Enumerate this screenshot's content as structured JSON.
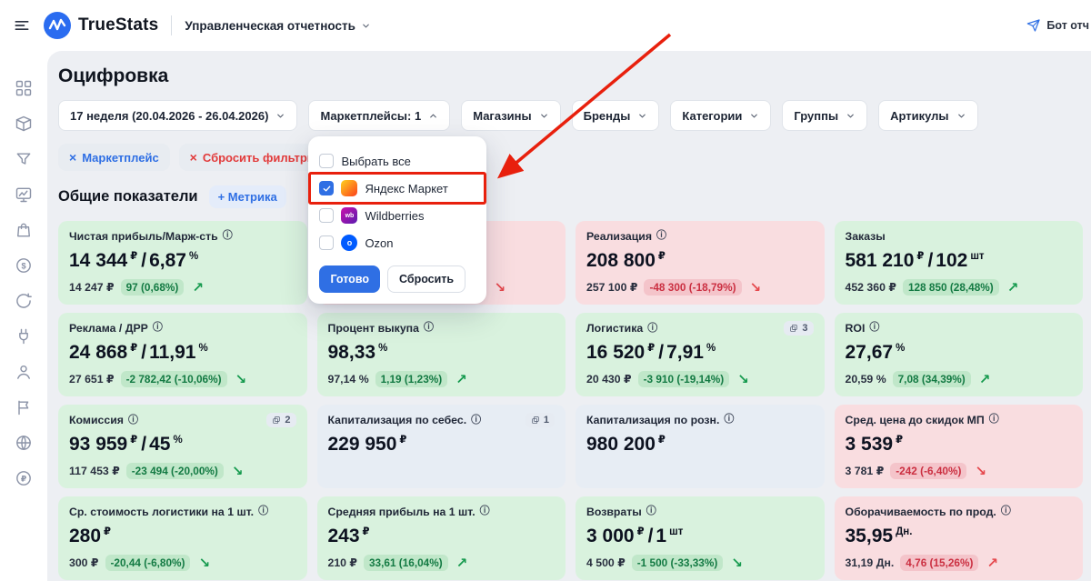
{
  "colors": {
    "accent_blue": "#2f6fe4",
    "good_bg": "#d9f2de",
    "bad_bg": "#f9dde0",
    "neutral_bg": "#e7edf4",
    "good_text": "#137a43",
    "bad_text": "#cb2f41",
    "annotation_red": "#e8200d"
  },
  "header": {
    "app_name": "TrueStats",
    "section_label": "Управленческая отчетность",
    "bot_label": "Бот отч"
  },
  "sidebar": {
    "icons": [
      "grid",
      "box",
      "filter",
      "chart",
      "bag",
      "dollar-circle",
      "sync",
      "plug",
      "user",
      "flag",
      "globe",
      "ruble-circle"
    ]
  },
  "page": {
    "title": "Оцифровка",
    "week_filter": "17 неделя (20.04.2026 - 26.04.2026)",
    "filter_buttons": [
      {
        "label": "Маркетплейсы: 1",
        "open": true
      },
      {
        "label": "Магазины"
      },
      {
        "label": "Бренды"
      },
      {
        "label": "Категории"
      },
      {
        "label": "Группы"
      },
      {
        "label": "Артикулы"
      }
    ],
    "chips": [
      {
        "label": "Маркетплейс",
        "color": "blue"
      },
      {
        "label": "Сбросить фильтры",
        "color": "red"
      }
    ],
    "section_title": "Общие показатели",
    "add_metric_label": "+ Метрика"
  },
  "marketplace_dropdown": {
    "select_all": "Выбрать все",
    "options": [
      {
        "label": "Яндекс Маркет",
        "checked": true,
        "icon": "yandex",
        "highlighted": true
      },
      {
        "label": "Wildberries",
        "checked": false,
        "icon": "wb"
      },
      {
        "label": "Ozon",
        "checked": false,
        "icon": "ozon"
      }
    ],
    "done_label": "Готово",
    "reset_label": "Сбросить"
  },
  "cards": [
    {
      "title": "Чистая прибыль/Марж-сть",
      "info": true,
      "tone": "good",
      "values": [
        {
          "n": "14 344",
          "u": "₽"
        },
        {
          "n": "6,87",
          "u": "%"
        }
      ],
      "prev": "14 247 ₽",
      "change": "97 (0,68%)",
      "change_tone": "good",
      "trend": "up"
    },
    {
      "title": "",
      "info": false,
      "tone": "bad",
      "covered": true,
      "values": [],
      "prev": "",
      "change": "",
      "change_tone": "bad",
      "trend": "down"
    },
    {
      "title": "Реализация",
      "info": true,
      "tone": "bad",
      "values": [
        {
          "n": "208 800",
          "u": "₽"
        }
      ],
      "prev": "257 100 ₽",
      "change": "-48 300 (-18,79%)",
      "change_tone": "bad",
      "trend": "down"
    },
    {
      "title": "Заказы",
      "info": false,
      "tone": "good",
      "values": [
        {
          "n": "581 210",
          "u": "₽"
        },
        {
          "n": "102",
          "u": "шт"
        }
      ],
      "prev": "452 360 ₽",
      "change": "128 850 (28,48%)",
      "change_tone": "good",
      "trend": "up"
    },
    {
      "title": "Реклама / ДРР",
      "info": true,
      "tone": "good",
      "values": [
        {
          "n": "24 868",
          "u": "₽"
        },
        {
          "n": "11,91",
          "u": "%"
        }
      ],
      "prev": "27 651 ₽",
      "change": "-2 782,42 (-10,06%)",
      "change_tone": "good",
      "trend": "down"
    },
    {
      "title": "Процент выкупа",
      "info": true,
      "tone": "good",
      "values": [
        {
          "n": "98,33",
          "u": "%"
        }
      ],
      "prev": "97,14 %",
      "change": "1,19 (1,23%)",
      "change_tone": "good",
      "trend": "up"
    },
    {
      "title": "Логистика",
      "info": true,
      "badge": "3",
      "tone": "good",
      "values": [
        {
          "n": "16 520",
          "u": "₽"
        },
        {
          "n": "7,91",
          "u": "%"
        }
      ],
      "prev": "20 430 ₽",
      "change": "-3 910 (-19,14%)",
      "change_tone": "good",
      "trend": "down"
    },
    {
      "title": "ROI",
      "info": true,
      "tone": "good",
      "values": [
        {
          "n": "27,67",
          "u": "%"
        }
      ],
      "prev": "20,59 %",
      "change": "7,08 (34,39%)",
      "change_tone": "good",
      "trend": "up"
    },
    {
      "title": "Комиссия",
      "info": true,
      "badge": "2",
      "tone": "good",
      "values": [
        {
          "n": "93 959",
          "u": "₽"
        },
        {
          "n": "45",
          "u": "%"
        }
      ],
      "prev": "117 453 ₽",
      "change": "-23 494 (-20,00%)",
      "change_tone": "good",
      "trend": "down"
    },
    {
      "title": "Капитализация по себес.",
      "info": true,
      "badge": "1",
      "tone": "neutral",
      "values": [
        {
          "n": "229 950",
          "u": "₽"
        }
      ],
      "prev": "",
      "change": "",
      "change_tone": "good",
      "trend": "up"
    },
    {
      "title": "Капитализация по розн.",
      "info": true,
      "tone": "neutral",
      "values": [
        {
          "n": "980 200",
          "u": "₽"
        }
      ],
      "prev": "",
      "change": "",
      "change_tone": "good",
      "trend": "up"
    },
    {
      "title": "Сред. цена до скидок МП",
      "info": true,
      "tone": "bad",
      "values": [
        {
          "n": "3 539",
          "u": "₽"
        }
      ],
      "prev": "3 781 ₽",
      "change": "-242 (-6,40%)",
      "change_tone": "bad",
      "trend": "down"
    },
    {
      "title": "Ср. стоимость логистики на 1 шт.",
      "info": true,
      "tone": "good",
      "values": [
        {
          "n": "280",
          "u": "₽"
        }
      ],
      "prev": "300 ₽",
      "change": "-20,44 (-6,80%)",
      "change_tone": "good",
      "trend": "down"
    },
    {
      "title": "Средняя прибыль на 1 шт.",
      "info": true,
      "tone": "good",
      "values": [
        {
          "n": "243",
          "u": "₽"
        }
      ],
      "prev": "210 ₽",
      "change": "33,61 (16,04%)",
      "change_tone": "good",
      "trend": "up"
    },
    {
      "title": "Возвраты",
      "info": true,
      "tone": "good",
      "values": [
        {
          "n": "3 000",
          "u": "₽"
        },
        {
          "n": "1",
          "u": "шт"
        }
      ],
      "prev": "4 500 ₽",
      "change": "-1 500 (-33,33%)",
      "change_tone": "good",
      "trend": "down"
    },
    {
      "title": "Оборачиваемость по прод.",
      "info": true,
      "tone": "bad",
      "values": [
        {
          "n": "35,95",
          "u": "Дн."
        }
      ],
      "prev": "31,19 Дн.",
      "change": "4,76 (15,26%)",
      "change_tone": "bad",
      "trend": "up"
    }
  ]
}
